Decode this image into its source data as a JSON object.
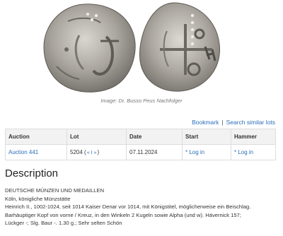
{
  "image": {
    "caption": "Image: Dr. Busso Peus Nachfolger",
    "alt": "coin obverse and reverse"
  },
  "links": {
    "bookmark": "Bookmark",
    "separator": "|",
    "search_similar": "Search similar lots"
  },
  "table": {
    "headers": {
      "auction": "Auction",
      "lot": "Lot",
      "date": "Date",
      "start": "Start",
      "hammer": "Hammer"
    },
    "row": {
      "auction": "Auction 441",
      "lot_number": "5204",
      "lot_open": "(",
      "lot_prev": "«",
      "lot_list": "I",
      "lot_next": "»",
      "lot_close": ")",
      "date": "07.11.2024",
      "start": "* Log in",
      "hammer": "* Log in"
    }
  },
  "description": {
    "heading": "Description",
    "lines": [
      "DEUTSCHE MÜNZEN UND MEDAILLEN",
      "Köln, königliche Münzstätte",
      "Heinrich II., 1002-1024, seit 1014 Kaiser Denar vor 1014, mit Königstitel, möglicherweise ein Beischlag.",
      "Barhäuptiger Kopf von vorne / Kreuz, in den Winkeln 2 Kugeln sowie Alpha (und w). Hävernick 157;",
      "Lückger -; Slg. Baur -. 1.30 g.; Sehr selten Schön"
    ]
  }
}
